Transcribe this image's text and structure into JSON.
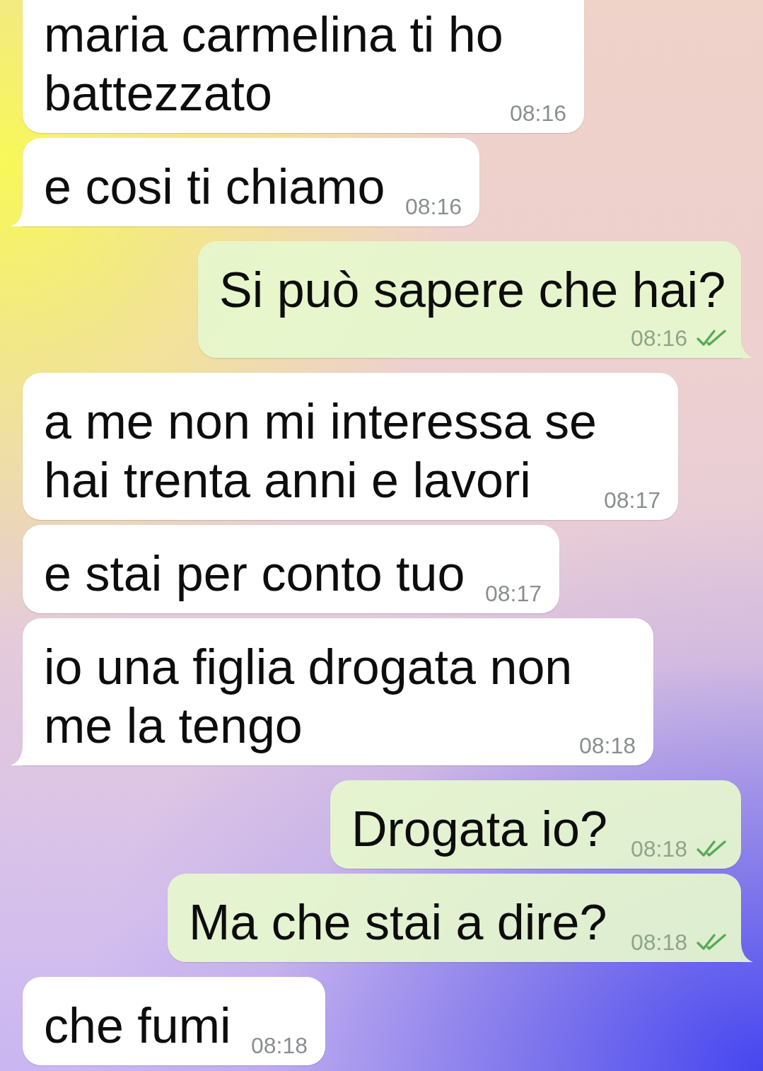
{
  "messages": [
    {
      "kind": "incoming",
      "text": "maria carmelina ti ho battezzato",
      "time": "08:16",
      "tail": false
    },
    {
      "kind": "incoming",
      "text": "e cosi ti chiamo",
      "time": "08:16",
      "tail": true
    },
    {
      "kind": "outgoing",
      "text": "Si può sapere che hai?",
      "time": "08:16",
      "tail": true,
      "read": true
    },
    {
      "kind": "incoming",
      "text": "a me non mi interessa se hai trenta anni e lavori",
      "time": "08:17",
      "tail": false
    },
    {
      "kind": "incoming",
      "text": "e stai per conto tuo",
      "time": "08:17",
      "tail": false
    },
    {
      "kind": "incoming",
      "text": "io una figlia drogata non me la tengo",
      "time": "08:18",
      "tail": true
    },
    {
      "kind": "outgoing",
      "text": "Drogata io?",
      "time": "08:18",
      "tail": false,
      "read": true
    },
    {
      "kind": "outgoing",
      "text": "Ma che stai a dire?",
      "time": "08:18",
      "tail": true,
      "read": true
    },
    {
      "kind": "incoming",
      "text": "che fumi",
      "time": "08:18",
      "tail": false
    }
  ]
}
